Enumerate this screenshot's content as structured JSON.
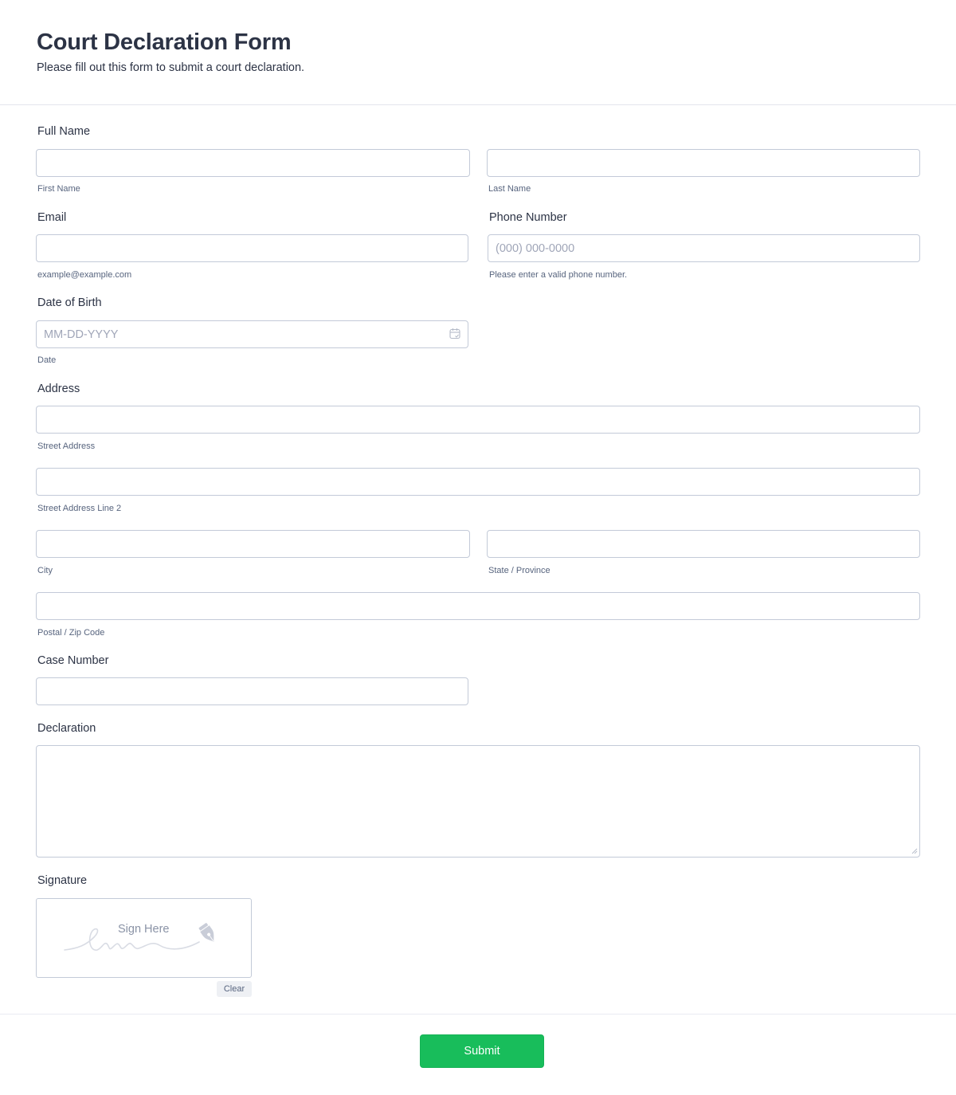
{
  "header": {
    "title": "Court Declaration Form",
    "subtitle": "Please fill out this form to submit a court declaration."
  },
  "fields": {
    "full_name": {
      "label": "Full Name",
      "first": {
        "value": "",
        "placeholder": "",
        "sublabel": "First Name"
      },
      "last": {
        "value": "",
        "placeholder": "",
        "sublabel": "Last Name"
      }
    },
    "email": {
      "label": "Email",
      "value": "",
      "placeholder": "",
      "sublabel": "example@example.com"
    },
    "phone": {
      "label": "Phone Number",
      "value": "",
      "placeholder": "(000) 000-0000",
      "sublabel": "Please enter a valid phone number."
    },
    "dob": {
      "label": "Date of Birth",
      "value": "",
      "placeholder": "MM-DD-YYYY",
      "sublabel": "Date",
      "icon": "calendar-icon"
    },
    "address": {
      "label": "Address",
      "street": {
        "value": "",
        "sublabel": "Street Address"
      },
      "street2": {
        "value": "",
        "sublabel": "Street Address Line 2"
      },
      "city": {
        "value": "",
        "sublabel": "City"
      },
      "state": {
        "value": "",
        "sublabel": "State / Province"
      },
      "zip": {
        "value": "",
        "sublabel": "Postal / Zip Code"
      }
    },
    "case_number": {
      "label": "Case Number",
      "value": ""
    },
    "declaration": {
      "label": "Declaration",
      "value": ""
    },
    "signature": {
      "label": "Signature",
      "placeholder": "Sign Here",
      "icon": "pen-nib-icon",
      "clear_label": "Clear"
    }
  },
  "footer": {
    "submit_label": "Submit"
  },
  "colors": {
    "text": "#2c3345",
    "sublabel": "#57647e",
    "border": "#c3cad8",
    "placeholder": "#a0a6b8",
    "submit": "#18bd5b"
  }
}
